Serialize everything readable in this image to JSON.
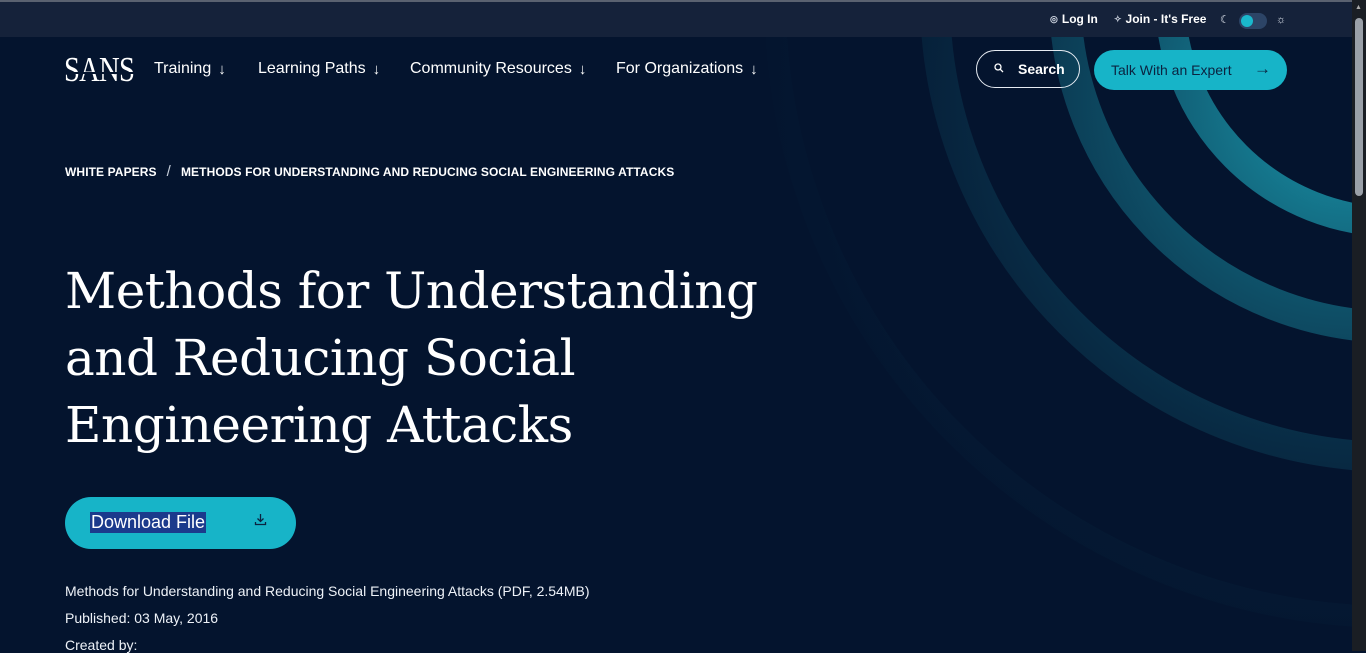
{
  "utility": {
    "login_label": "Log In",
    "join_label": "Join - It's Free"
  },
  "nav": {
    "logo_text": "SANS",
    "items": [
      {
        "label": "Training"
      },
      {
        "label": "Learning Paths"
      },
      {
        "label": "Community Resources"
      },
      {
        "label": "For Organizations"
      }
    ],
    "search_label": "Search",
    "expert_label": "Talk With an Expert"
  },
  "breadcrumb": {
    "parent": "WHITE PAPERS",
    "separator": "/",
    "current": "METHODS FOR UNDERSTANDING AND REDUCING SOCIAL ENGINEERING ATTACKS"
  },
  "hero": {
    "title": "Methods for Understanding and Reducing Social Engineering Attacks",
    "download_label": "Download File"
  },
  "meta": {
    "file_info": "Methods for Understanding and Reducing Social Engineering Attacks (PDF, 2.54MB)",
    "published": "Published: 03 May, 2016",
    "created_by": "Created by:"
  },
  "colors": {
    "background": "#04142e",
    "accent": "#17b4c8",
    "utility_bar": "#15223a"
  },
  "icons": {
    "login": "user-circle-icon",
    "join": "sparkle-icon",
    "theme_dark": "moon-icon",
    "theme_light": "sun-icon",
    "search": "search-icon",
    "arrow": "arrow-right-icon",
    "download": "download-icon"
  }
}
